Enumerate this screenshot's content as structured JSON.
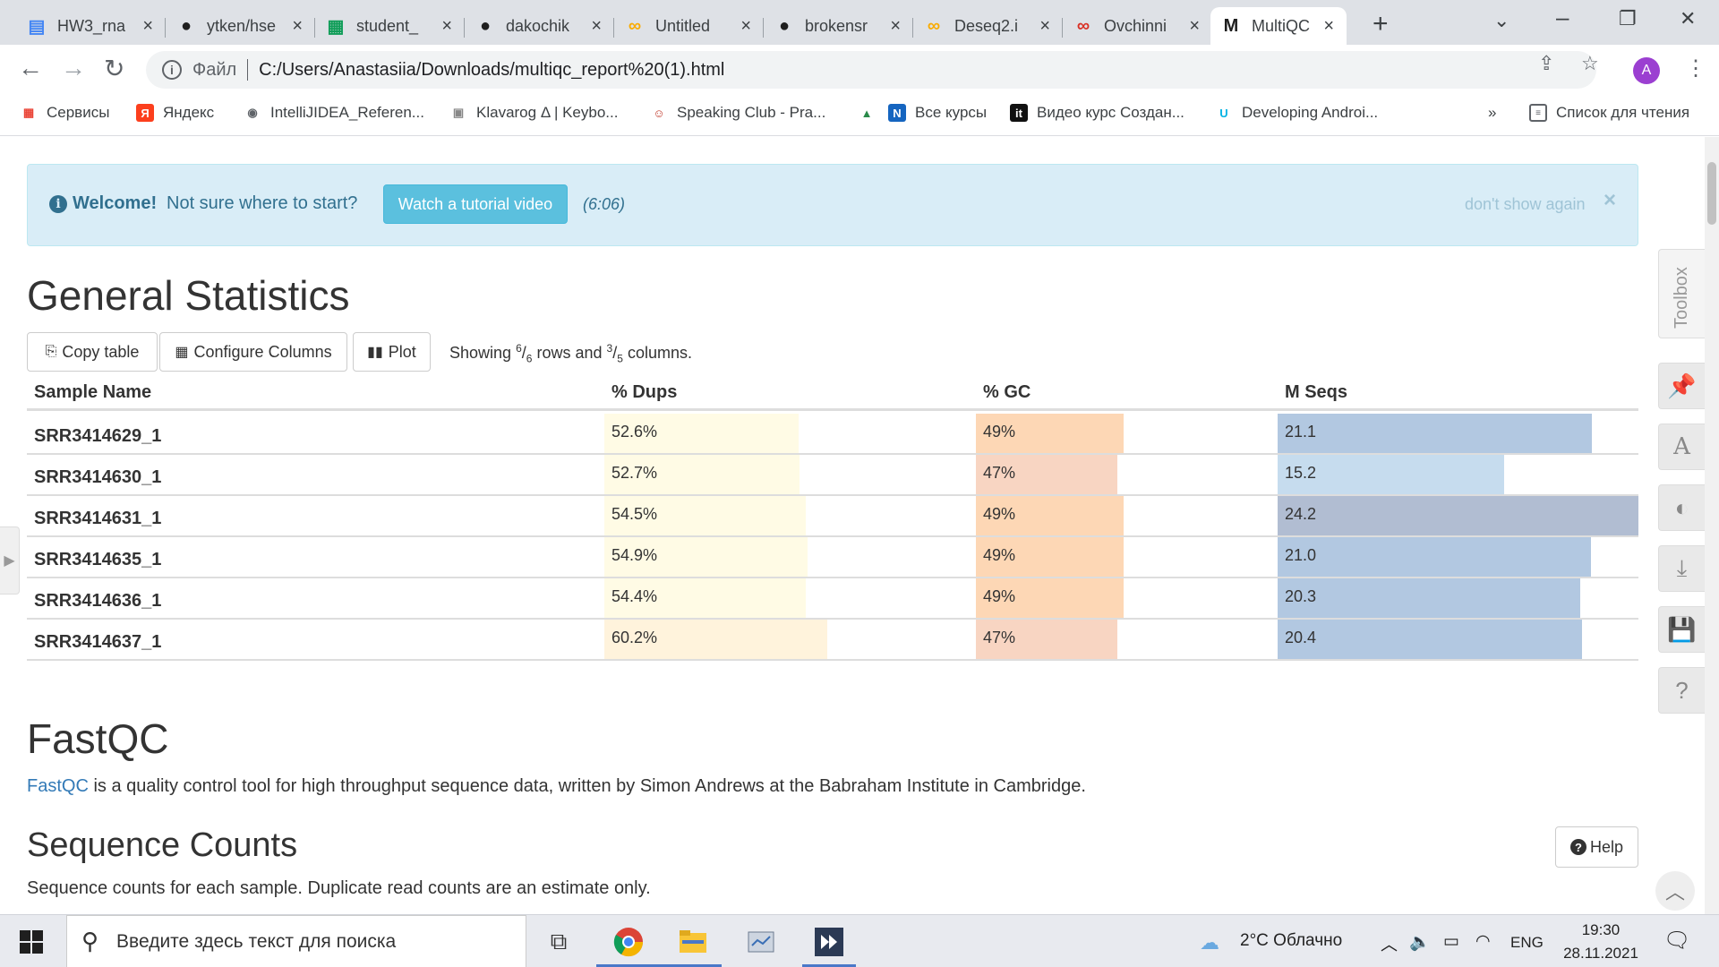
{
  "browser": {
    "tabs": [
      {
        "title": "HW3_rna",
        "icon": "google-docs-icon",
        "color": "#4285f4"
      },
      {
        "title": "ytken/hse",
        "icon": "github-icon",
        "color": "#1f1f1f"
      },
      {
        "title": "student_",
        "icon": "google-sheets-icon",
        "color": "#0f9d58"
      },
      {
        "title": "dakochik",
        "icon": "github-icon",
        "color": "#1f1f1f"
      },
      {
        "title": "Untitled",
        "icon": "colab-icon",
        "color": "#f9ab00"
      },
      {
        "title": "brokensr",
        "icon": "github-icon",
        "color": "#1f1f1f"
      },
      {
        "title": "Deseq2.i",
        "icon": "colab-icon",
        "color": "#f9ab00"
      },
      {
        "title": "Ovchinni",
        "icon": "colab-red-icon",
        "color": "#d93025"
      },
      {
        "title": "MultiQC",
        "icon": "multiqc-icon",
        "color": "#1f1f1f",
        "active": true
      }
    ],
    "address_label": "Файл",
    "url": "C:/Users/Anastasiia/Downloads/multiqc_report%20(1).html",
    "profile_initial": "A",
    "bookmarks": [
      {
        "label": "Сервисы",
        "icon": "apps-grid-icon"
      },
      {
        "label": "Яндекс",
        "icon": "yandex-icon"
      },
      {
        "label": "IntelliJIDEA_Referen...",
        "icon": "globe-icon"
      },
      {
        "label": "Klavarog Δ | Keybo...",
        "icon": "page-icon"
      },
      {
        "label": "Speaking Club - Pra...",
        "icon": "speaking-club-icon"
      },
      {
        "label": "",
        "icon": "android-icon"
      },
      {
        "label": "Все курсы",
        "icon": "courses-icon"
      },
      {
        "label": "Видео курс Создан...",
        "icon": "it-icon"
      },
      {
        "label": "Developing Androi...",
        "icon": "udacity-icon"
      }
    ],
    "bookmarks_more": "»",
    "reading_list": "Список для чтения"
  },
  "welcome": {
    "title": "Welcome!",
    "text": "Not sure where to start?",
    "button": "Watch a tutorial video",
    "duration": "(6:06)",
    "dont_show": "don't show again",
    "close": "×"
  },
  "general_stats": {
    "title": "General Statistics",
    "copy_btn": "Copy table",
    "configure_btn": "Configure Columns",
    "plot_btn": "Plot",
    "showing_prefix": "Showing",
    "rows_shown": "6",
    "rows_total": "6",
    "rows_mid": "rows and",
    "cols_shown": "3",
    "cols_total": "5",
    "cols_suffix": "columns.",
    "headers": [
      "Sample Name",
      "% Dups",
      "% GC",
      "M Seqs"
    ],
    "rows": [
      {
        "name": "SRR3414629_1",
        "dups": "52.6%",
        "dups_v": 52.6,
        "gc": "49%",
        "gc_v": 49,
        "mseqs": "21.1",
        "mseqs_v": 21.1
      },
      {
        "name": "SRR3414630_1",
        "dups": "52.7%",
        "dups_v": 52.7,
        "gc": "47%",
        "gc_v": 47,
        "mseqs": "15.2",
        "mseqs_v": 15.2
      },
      {
        "name": "SRR3414631_1",
        "dups": "54.5%",
        "dups_v": 54.5,
        "gc": "49%",
        "gc_v": 49,
        "mseqs": "24.2",
        "mseqs_v": 24.2
      },
      {
        "name": "SRR3414635_1",
        "dups": "54.9%",
        "dups_v": 54.9,
        "gc": "49%",
        "gc_v": 49,
        "mseqs": "21.0",
        "mseqs_v": 21.0
      },
      {
        "name": "SRR3414636_1",
        "dups": "54.4%",
        "dups_v": 54.4,
        "gc": "49%",
        "gc_v": 49,
        "mseqs": "20.3",
        "mseqs_v": 20.3
      },
      {
        "name": "SRR3414637_1",
        "dups": "60.2%",
        "dups_v": 60.2,
        "gc": "47%",
        "gc_v": 47,
        "mseqs": "20.4",
        "mseqs_v": 20.4
      }
    ],
    "colors": {
      "dups": "#fffbe5",
      "dups_high": "#fff3dc",
      "gc_49": "#fdd7b5",
      "gc_47": "#f8d5c2",
      "mseqs": "#b2c8e1",
      "mseqs_low": "#c6dcee",
      "mseqs_high": "#b1bdd2"
    }
  },
  "fastqc": {
    "title": "FastQC",
    "link": "FastQC",
    "desc": "is a quality control tool for high throughput sequence data, written by Simon Andrews at the Babraham Institute in Cambridge."
  },
  "sequence_counts": {
    "title": "Sequence Counts",
    "help": "Help",
    "desc": "Sequence counts for each sample. Duplicate read counts are an estimate only."
  },
  "toolbox": {
    "label": "Toolbox"
  },
  "taskbar": {
    "search_placeholder": "Введите здесь текст для поиска",
    "weather": "2°C  Облачно",
    "lang": "ENG",
    "time": "19:30",
    "date": "28.11.2021"
  }
}
